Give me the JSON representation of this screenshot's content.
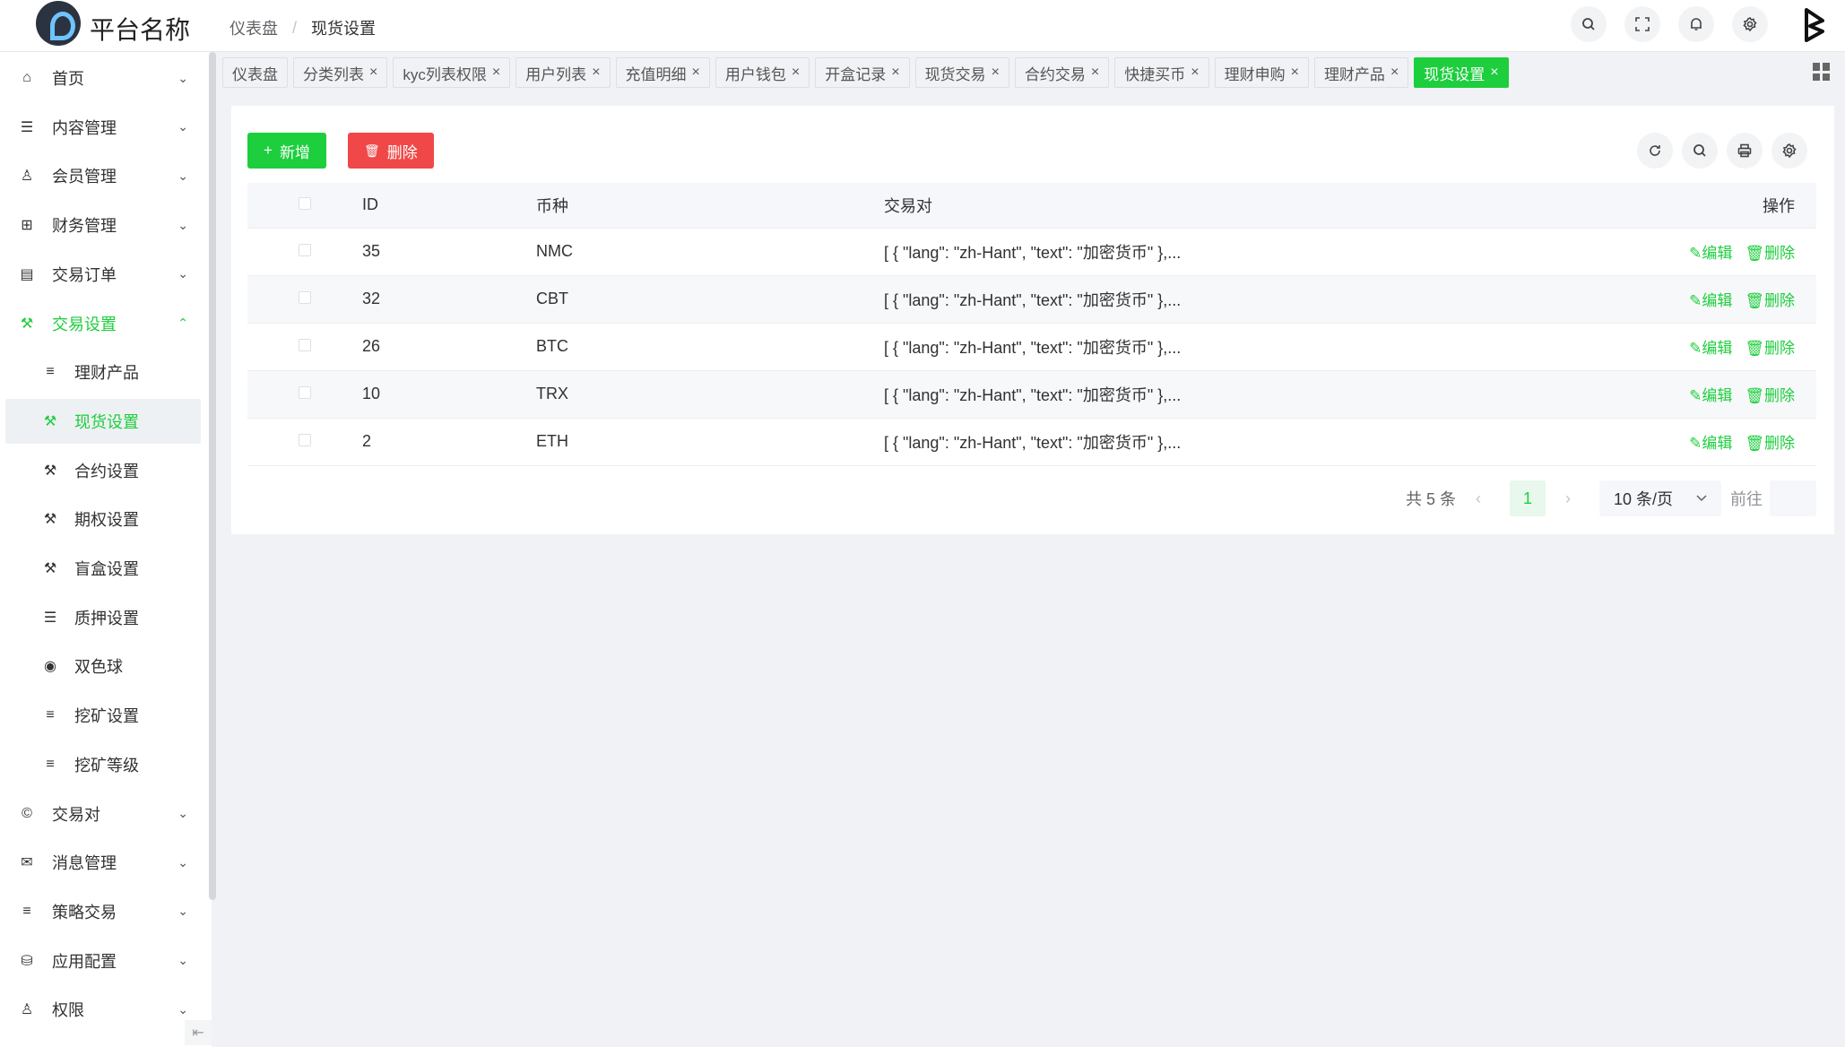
{
  "header": {
    "brand": "平台名称",
    "breadcrumb": [
      "仪表盘",
      "现货设置"
    ],
    "breadcrumb_sep": "/",
    "icons": [
      "search-icon",
      "fullscreen-icon",
      "bell-icon",
      "gear-icon"
    ]
  },
  "sidebar": {
    "items": [
      {
        "label": "首页",
        "icon": "home-icon",
        "glyph": "⌂",
        "chevron": "⌄"
      },
      {
        "label": "内容管理",
        "icon": "list-icon",
        "glyph": "☰",
        "chevron": "⌄"
      },
      {
        "label": "会员管理",
        "icon": "user-icon",
        "glyph": "♙",
        "chevron": "⌄"
      },
      {
        "label": "财务管理",
        "icon": "finance-icon",
        "glyph": "⊞",
        "chevron": "⌄"
      },
      {
        "label": "交易订单",
        "icon": "order-icon",
        "glyph": "▤",
        "chevron": "⌄"
      },
      {
        "label": "交易设置",
        "icon": "wrench-icon",
        "glyph": "⚒",
        "chevron": "⌃"
      },
      {
        "label": "理财产品",
        "icon": "filter-icon",
        "glyph": "≡"
      },
      {
        "label": "现货设置",
        "icon": "wrench-icon",
        "glyph": "⚒"
      },
      {
        "label": "合约设置",
        "icon": "wrench-icon",
        "glyph": "⚒"
      },
      {
        "label": "期权设置",
        "icon": "wrench-icon",
        "glyph": "⚒"
      },
      {
        "label": "盲盒设置",
        "icon": "wrench-icon",
        "glyph": "⚒"
      },
      {
        "label": "质押设置",
        "icon": "list-icon",
        "glyph": "☰"
      },
      {
        "label": "双色球",
        "icon": "target-icon",
        "glyph": "◉"
      },
      {
        "label": "挖矿设置",
        "icon": "filter-icon",
        "glyph": "≡"
      },
      {
        "label": "挖矿等级",
        "icon": "filter-icon",
        "glyph": "≡"
      },
      {
        "label": "交易对",
        "icon": "copyright-icon",
        "glyph": "©",
        "chevron": "⌄"
      },
      {
        "label": "消息管理",
        "icon": "mail-icon",
        "glyph": "✉",
        "chevron": "⌄"
      },
      {
        "label": "策略交易",
        "icon": "menu-icon",
        "glyph": "≡",
        "chevron": "⌄"
      },
      {
        "label": "应用配置",
        "icon": "config-icon",
        "glyph": "⛁",
        "chevron": "⌄"
      },
      {
        "label": "权限",
        "icon": "user-key-icon",
        "glyph": "♙",
        "chevron": "⌄"
      }
    ],
    "collapse_glyph": "⇤"
  },
  "tabs": [
    {
      "label": "仪表盘",
      "closable": false
    },
    {
      "label": "分类列表",
      "closable": true
    },
    {
      "label": "kyc列表权限",
      "closable": true
    },
    {
      "label": "用户列表",
      "closable": true
    },
    {
      "label": "充值明细",
      "closable": true
    },
    {
      "label": "用户钱包",
      "closable": true
    },
    {
      "label": "开盒记录",
      "closable": true
    },
    {
      "label": "现货交易",
      "closable": true
    },
    {
      "label": "合约交易",
      "closable": true
    },
    {
      "label": "快捷买币",
      "closable": true
    },
    {
      "label": "理财申购",
      "closable": true
    },
    {
      "label": "理财产品",
      "closable": true
    },
    {
      "label": "现货设置",
      "closable": true,
      "active": true
    }
  ],
  "toolbar": {
    "add_label": "新增",
    "add_glyph": "+",
    "delete_label": "删除",
    "delete_glyph": "🗑",
    "tools": [
      "refresh-icon",
      "search-icon",
      "print-icon",
      "gear-icon"
    ]
  },
  "table": {
    "columns": [
      "ID",
      "币种",
      "交易对",
      "操作"
    ],
    "rows": [
      {
        "id": "35",
        "coin": "NMC",
        "pair": "[ { \"lang\": \"zh-Hant\", \"text\": \"加密货币\" },..."
      },
      {
        "id": "32",
        "coin": "CBT",
        "pair": "[ { \"lang\": \"zh-Hant\", \"text\": \"加密货币\" },..."
      },
      {
        "id": "26",
        "coin": "BTC",
        "pair": "[ { \"lang\": \"zh-Hant\", \"text\": \"加密货币\" },..."
      },
      {
        "id": "10",
        "coin": "TRX",
        "pair": "[ { \"lang\": \"zh-Hant\", \"text\": \"加密货币\" },..."
      },
      {
        "id": "2",
        "coin": "ETH",
        "pair": "[ { \"lang\": \"zh-Hant\", \"text\": \"加密货币\" },..."
      }
    ],
    "edit_label": "✎编辑",
    "delete_label": "🗑删除"
  },
  "pagination": {
    "total": "共 5 条",
    "prev": "‹",
    "current": "1",
    "next": "›",
    "page_size": "10 条/页",
    "goto": "前往",
    "goto_value": ""
  },
  "colors": {
    "accent": "#1dce3d",
    "danger": "#f04848"
  }
}
